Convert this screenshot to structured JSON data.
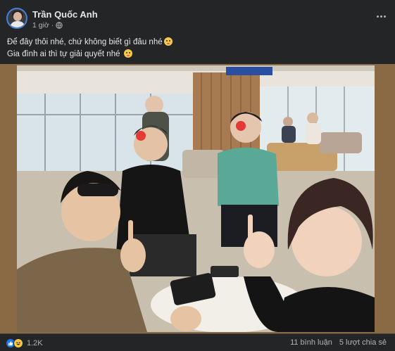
{
  "post": {
    "author": "Trần Quốc Anh",
    "time": "1 giờ",
    "separator": "·",
    "caption_line1": "Để đây thôi nhé, chứ không biết gì đâu nhé",
    "caption_line2": "Gia đình ai thì tự giải quyết nhé"
  },
  "photo": {
    "board_text": "",
    "description_alt": ""
  },
  "footer": {
    "reaction_count": "1.2K",
    "comments": "11 bình luận",
    "shares": "5 lượt chia sẻ"
  },
  "icons": {
    "privacy": "globe-icon",
    "more": "more-options-icon",
    "reaction1": "like-icon",
    "reaction2": "haha-icon"
  },
  "colors": {
    "background": "#242526",
    "text_primary": "#e4e6eb",
    "text_secondary": "#b0b3b8",
    "like_blue": "#1877f2",
    "haha_yellow": "#f7c948"
  }
}
